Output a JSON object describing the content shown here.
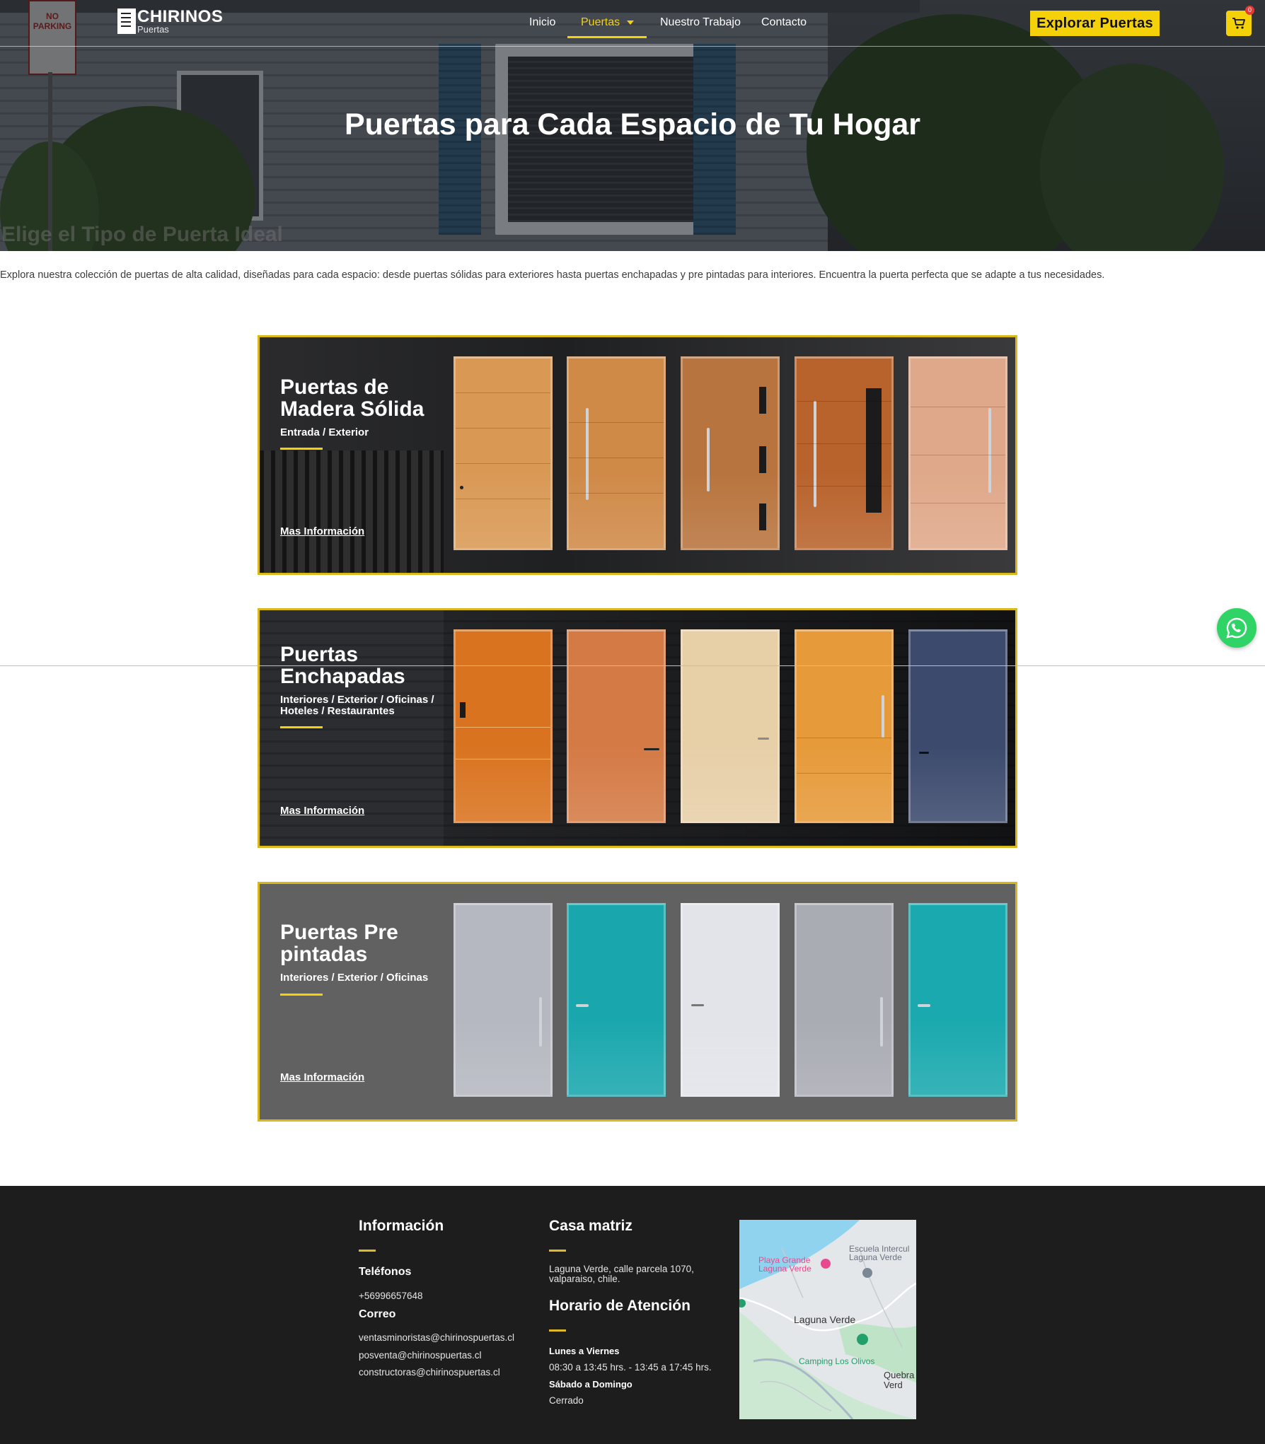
{
  "nav": {
    "logo_main": "CHIRINOS",
    "logo_sub": "Puertas",
    "items": [
      {
        "label": "Inicio"
      },
      {
        "label": "Puertas"
      },
      {
        "label": "Nuestro Trabajo"
      },
      {
        "label": "Contacto"
      }
    ],
    "active_item": "Puertas",
    "cta_label": "Explorar Puertas",
    "cart_count": "0"
  },
  "hero": {
    "sign_text": "NO PARKING",
    "title": "Puertas para Cada Espacio de Tu Hogar",
    "faded_heading": "Elige el Tipo de Puerta Ideal"
  },
  "intro": "Explora nuestra colección de puertas de alta calidad, diseñadas para cada espacio: desde puertas sólidas para exteriores hasta puertas enchapadas y pre pintadas para interiores. Encuentra la puerta perfecta que se adapte a tus necesidades.",
  "categories": [
    {
      "title_line1": "Puertas de",
      "title_line2": "Madera Sólida",
      "subtitle_line1": "Entrada / Exterior",
      "subtitle_line2": "",
      "link": "Mas Información",
      "door_colors": [
        "#d99955",
        "#cf8a48",
        "#b8743e",
        "#b8632c",
        "#dfa88a"
      ]
    },
    {
      "title_line1": "Puertas",
      "title_line2": "Enchapadas",
      "subtitle_line1": "Interiores / Exterior / Oficinas /",
      "subtitle_line2": "Hoteles / Restaurantes",
      "link": "Mas Información",
      "door_colors": [
        "#d9731f",
        "#d47a45",
        "#e7cfa8",
        "#e69a3a",
        "#3c4a6d"
      ]
    },
    {
      "title_line1": "Puertas Pre",
      "title_line2": "pintadas",
      "subtitle_line1": "Interiores / Exterior / Oficinas",
      "subtitle_line2": "",
      "link": "Mas Información",
      "door_colors": [
        "#b5b8c0",
        "#19a7ad",
        "#e2e4ea",
        "#a9acb3",
        "#1aa9ae"
      ]
    }
  ],
  "footer": {
    "info": {
      "heading": "Información",
      "phones_label": "Teléfonos",
      "phone": "+56996657648",
      "email_label": "Correo",
      "emails": [
        "ventasminoristas@chirinospuertas.cl",
        "posventa@chirinospuertas.cl",
        "constructoras@chirinospuertas.cl"
      ]
    },
    "office": {
      "heading": "Casa matriz",
      "address_line1": "Laguna Verde, calle parcela 1070,",
      "address_line2": "valparaiso, chile.",
      "hours_heading": "Horario de Atención",
      "weekdays_label": "Lunes a Viernes",
      "weekdays_hours": "08:30 a 13:45 hrs. - 13:45 a 17:45 hrs.",
      "weekend_label": "Sábado a Domingo",
      "weekend_hours": "Cerrado"
    },
    "map": {
      "place1_line1": "Playa Grande",
      "place1_line2": "Laguna Verde",
      "place2_line1": "Escuela Intercul",
      "place2_line2": "Laguna Verde",
      "town": "Laguna Verde",
      "camping": "Camping Los Olivos",
      "place3_line1": "Quebra",
      "place3_line2": "Verd"
    }
  },
  "colors": {
    "accent": "#f5d10a",
    "card_border": "#d9b91a",
    "footer_bg": "#1d1d1d",
    "whatsapp": "#2fd366"
  }
}
